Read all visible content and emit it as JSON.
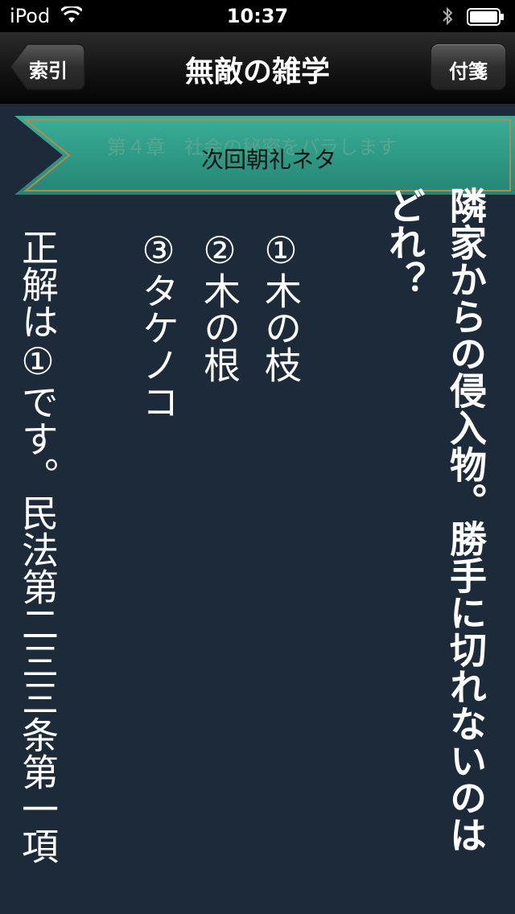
{
  "status_bar": {
    "carrier": "iPod",
    "time": "10:37",
    "icons": [
      "wifi-icon",
      "bluetooth-icon",
      "battery-icon"
    ]
  },
  "nav": {
    "back_label": "索引",
    "title": "無敵の雑学",
    "bookmark_label": "付箋"
  },
  "ribbon": {
    "chapter": "第４章　社会の秘密をバラします",
    "label": "次回朝礼ネタ"
  },
  "question": {
    "line1": "隣家からの侵入物。勝手に切れないのは",
    "line2": "どれ？"
  },
  "options": [
    "①木の枝",
    "②木の根",
    "③タケノコ"
  ],
  "answer": "正解は①です。民法第二三三条第一項",
  "colors": {
    "background": "#1c2a3a",
    "ribbon": "#2e9a86",
    "ribbon_border": "#b08c4a"
  }
}
